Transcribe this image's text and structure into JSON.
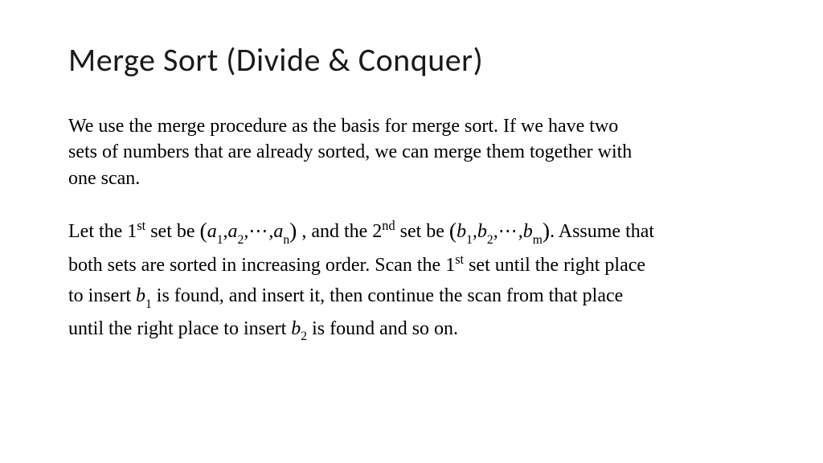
{
  "slide": {
    "title": "Merge Sort (Divide & Conquer)",
    "paragraph1": "We use the merge procedure as the basis for merge sort. If we have two sets of numbers that are already sorted, we can merge them together with one scan.",
    "p2_a": "Let the 1",
    "p2_a_ord": "st",
    "p2_b": " set be ",
    "set1": {
      "open": "(",
      "t1": "a",
      "s1": "1",
      "c1": ",",
      "t2": "a",
      "s2": "2",
      "c2": ",",
      "dots": "⋯",
      "c3": ",",
      "t3": "a",
      "s3": "n",
      "close": ")"
    },
    "p2_c": " , and the 2",
    "p2_c_ord": "nd",
    "p2_d": " set be ",
    "set2": {
      "open": "(",
      "t1": "b",
      "s1": "1",
      "c1": ",",
      "t2": "b",
      "s2": "2",
      "c2": ",",
      "dots": "⋯",
      "c3": ",",
      "t3": "b",
      "s3": "m",
      "close": ")"
    },
    "p2_e": ". Assume that both sets are sorted in increasing order. Scan the 1",
    "p2_e_ord": "st",
    "p2_f": " set until the right place to insert ",
    "b1": {
      "v": "b",
      "s": "1"
    },
    "p2_g": " is found, and insert it, then continue the scan from that place until the right place to insert ",
    "b2": {
      "v": "b",
      "s": "2"
    },
    "p2_h": "  is found and so on."
  }
}
